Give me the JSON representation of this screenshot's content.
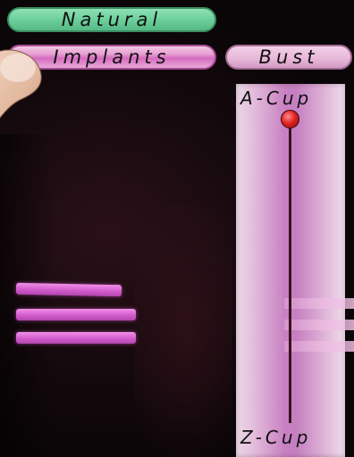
{
  "buttons": {
    "natural_label": "Natural",
    "implants_label": "Implants",
    "bust_label": "Bust"
  },
  "slider": {
    "top_label": "A-Cup",
    "bottom_label": "Z-Cup",
    "value_fraction": 0.0
  },
  "colors": {
    "natural_button": "#6fd29e",
    "implants_button": "#d56bc0",
    "slider_panel": "#c880c2",
    "slider_thumb": "#e02424",
    "stripes": "#d35ccd"
  }
}
